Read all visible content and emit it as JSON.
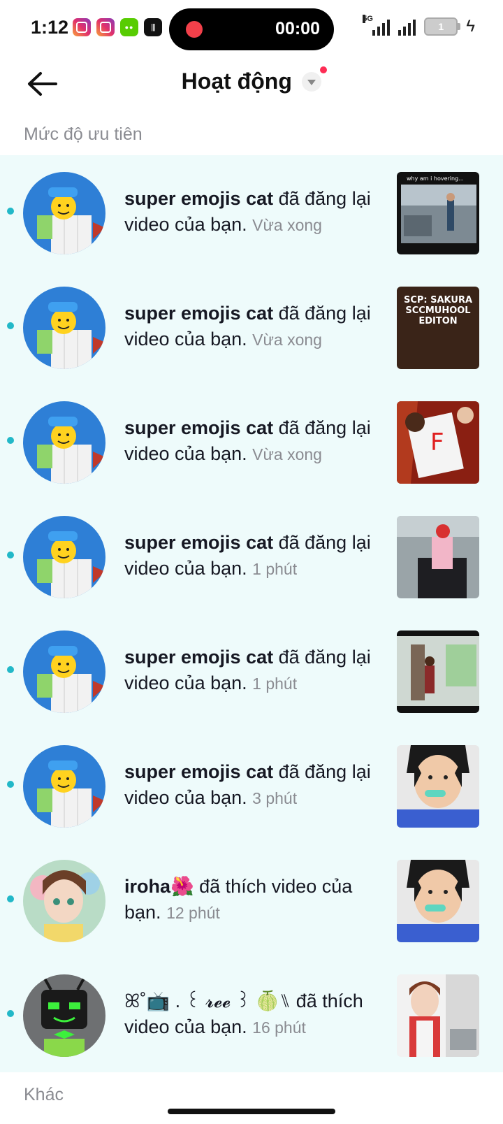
{
  "status_bar": {
    "time": "1:12",
    "recording_timer": "00:00",
    "network": "5G",
    "battery_level": "1",
    "app_icons": [
      "instagram-icon",
      "instagram-icon",
      "duolingo-icon",
      "voice-recorder-icon"
    ]
  },
  "header": {
    "title": "Hoạt động"
  },
  "sections": {
    "priority_label": "Mức độ ưu tiên",
    "other_label": "Khác"
  },
  "notifications": [
    {
      "user": "super emojis cat",
      "action": " đã đăng lại video của bạn.",
      "time": "Vừa xong",
      "thumb_caption": "why am i hovering..."
    },
    {
      "user": "super emojis cat",
      "action": " đã đăng lại video của bạn.",
      "time": "Vừa xong",
      "thumb_caption": "SCP: SAKURA SCCMUHOOL EDITON"
    },
    {
      "user": "super emojis cat",
      "action": " đã đăng lại video của bạn.",
      "time": "Vừa xong",
      "thumb_caption": ""
    },
    {
      "user": "super emojis cat",
      "action": " đã đăng lại video của bạn.",
      "time": "1 phút",
      "thumb_caption": ""
    },
    {
      "user": "super emojis cat",
      "action": " đã đăng lại video của bạn.",
      "time": "1 phút",
      "thumb_caption": ""
    },
    {
      "user": "super emojis cat",
      "action": " đã đăng lại video của bạn.",
      "time": "3 phút",
      "thumb_caption": ""
    },
    {
      "user": "iroha🌺",
      "action": " đã thích video của bạn.",
      "time": "12 phút",
      "thumb_caption": ""
    },
    {
      "user": "ꕤ˚📺 . ꒰ 𝓻𝓮𝓮 ꒱ 🍈⑊",
      "action": " đã thích video của bạn.",
      "time": "16 phút",
      "thumb_caption": ""
    }
  ],
  "colors": {
    "unread_dot": "#22b8c8",
    "list_background": "#eefbfb",
    "record_dot": "#f2404a",
    "badge": "#fe2c55"
  }
}
